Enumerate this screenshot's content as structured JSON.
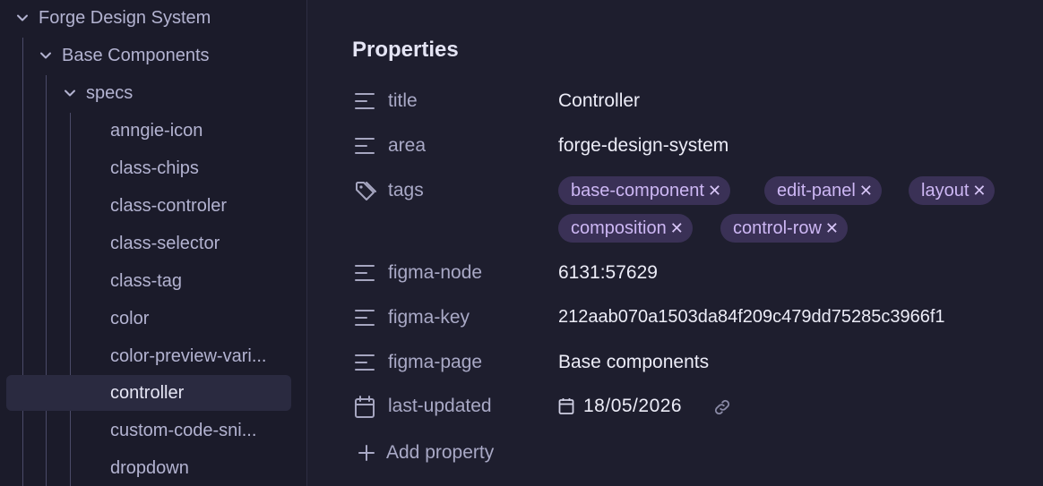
{
  "sidebar": {
    "root": "Forge Design System",
    "group": "Base Components",
    "folder": "specs",
    "items": [
      "anngie-icon",
      "class-chips",
      "class-controler",
      "class-selector",
      "class-tag",
      "color",
      "color-preview-vari...",
      "controller",
      "custom-code-sni...",
      "dropdown"
    ],
    "selected": "controller"
  },
  "properties": {
    "heading": "Properties",
    "title": {
      "key": "title",
      "value": "Controller",
      "icon": "text-lines-icon"
    },
    "area": {
      "key": "area",
      "value": "forge-design-system",
      "icon": "text-lines-icon"
    },
    "tags": {
      "key": "tags",
      "icon": "tag-icon",
      "values": [
        "base-component",
        "edit-panel",
        "layout",
        "composition",
        "control-row"
      ],
      "remove_glyph": "✕"
    },
    "figma_node": {
      "key": "figma-node",
      "value": "6131:57629",
      "icon": "text-lines-icon"
    },
    "figma_key": {
      "key": "figma-key",
      "value": "212aab070a1503da84f209c479dd75285c3966f1",
      "icon": "text-lines-icon"
    },
    "figma_page": {
      "key": "figma-page",
      "value": "Base components",
      "icon": "text-lines-icon"
    },
    "last_updated": {
      "key": "last-updated",
      "value": "18/05/2026",
      "icon": "calendar-icon"
    },
    "add_label": "Add property"
  },
  "colors": {
    "background": "#1e1e2e",
    "sidebar": "#1b1b2a",
    "tag_bg": "#3a3156",
    "tag_text": "#cdb7f4"
  }
}
